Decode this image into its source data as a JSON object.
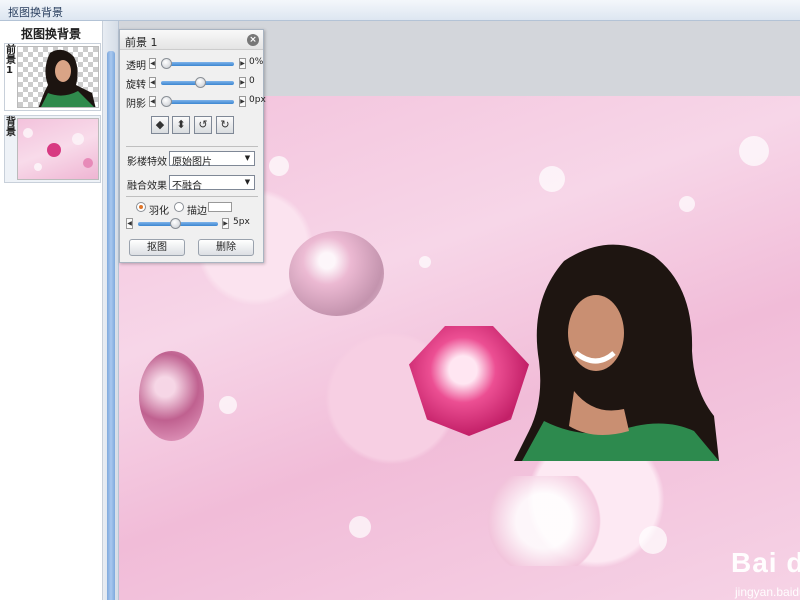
{
  "window": {
    "title": "抠图换背景"
  },
  "sidebar": {
    "title": "抠图换背景",
    "layers": [
      {
        "tag": "前景1",
        "selected": false
      },
      {
        "tag": "背景",
        "selected": true
      }
    ]
  },
  "panel": {
    "title": "前景 1",
    "close_icon": "close-icon",
    "sliders": [
      {
        "label": "透明",
        "value": "0%",
        "level": 0.0
      },
      {
        "label": "旋转",
        "value": "0",
        "level": 0.5
      },
      {
        "label": "阴影",
        "value": "0px",
        "level": 0.0
      }
    ],
    "tools": [
      "flip-horizontal-icon",
      "flip-vertical-icon",
      "rotate-left-icon",
      "rotate-right-icon"
    ],
    "effect_label": "影楼特效",
    "effect_value": "原始图片",
    "blend_label": "融合效果",
    "blend_value": "不融合",
    "feather_label": "羽化",
    "stroke_label": "描边",
    "feather_selected": true,
    "edge_value": "5px",
    "cutout_button": "抠图",
    "delete_button": "删除"
  },
  "watermark": {
    "brand": "Bai du 经验",
    "url": "jingyan.baidu.com"
  },
  "colors": {
    "accent": "#3c86d1",
    "canvas_pink": "#f3c2dc",
    "radio_dot": "#e0762b"
  }
}
